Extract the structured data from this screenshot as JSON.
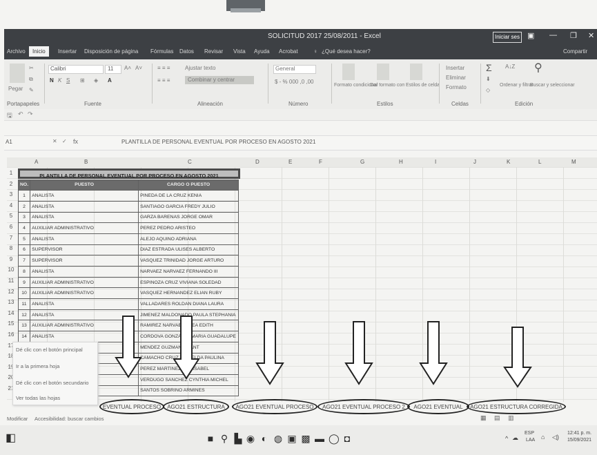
{
  "window": {
    "title": "SOLICITUD 2017 25/08/2011 - Excel",
    "sign_in": "Iniciar ses",
    "min": "—",
    "restore": "❐",
    "close": "✕"
  },
  "menu": [
    "Archivo",
    "Inicio",
    "Insertar",
    "Disposición de página",
    "Fórmulas",
    "Datos",
    "Revisar",
    "Vista",
    "Ayuda",
    "Acrobat",
    "¿Qué desea hacer?",
    "Compartir"
  ],
  "ribbon": {
    "paste": "Pegar",
    "font_name": "Calibri",
    "font_size": "11",
    "wrap_text": "Ajustar texto",
    "merge_center": "Combinar y centrar",
    "number_format": "General",
    "conditional_format": "Formato condicional",
    "format_as_table": "Dar formato como tabla",
    "cell_styles": "Estilos de celda",
    "insert": "Insertar",
    "delete": "Eliminar",
    "format": "Formato",
    "sort_filter": "Ordenar y filtrar",
    "find_select": "Buscar y seleccionar",
    "groups": [
      "Portapapeles",
      "Fuente",
      "Alineación",
      "Número",
      "Estilos",
      "Celdas",
      "Edición"
    ]
  },
  "formula_bar": {
    "cell_ref": "A1",
    "fx": "fx",
    "formula": "PLANTILLA DE PERSONAL EVENTUAL POR PROCESO EN AGOSTO 2021"
  },
  "columns": [
    "A",
    "B",
    "C",
    "D",
    "E",
    "F",
    "G",
    "H",
    "I",
    "J",
    "K",
    "L",
    "M"
  ],
  "table": {
    "title": "PLANTILLA DE PERSONAL EVENTUAL POR PROCESO EN AGOSTO 2021",
    "headers": [
      "NO.",
      "PUESTO",
      "CARGO O PUESTO"
    ],
    "rows": [
      {
        "n": "1",
        "puesto": "ANALISTA",
        "nombre": "PINEDA DE LA CRUZ KENIA"
      },
      {
        "n": "2",
        "puesto": "ANALISTA",
        "nombre": "SANTIAGO GARCIA FREDY JULIO"
      },
      {
        "n": "3",
        "puesto": "ANALISTA",
        "nombre": "GARZA BARENAS JORGE OMAR"
      },
      {
        "n": "4",
        "puesto": "AUXILIAR ADMINISTRATIVO",
        "nombre": "PEREZ PEDRO ARISTEO"
      },
      {
        "n": "5",
        "puesto": "ANALISTA",
        "nombre": "ALEJO AQUINO ADRIANA"
      },
      {
        "n": "6",
        "puesto": "SUPERVISOR",
        "nombre": "DIAZ ESTRADA ULISES ALBERTO"
      },
      {
        "n": "7",
        "puesto": "SUPERVISOR",
        "nombre": "VASQUEZ TRINIDAD JORGE ARTURO"
      },
      {
        "n": "8",
        "puesto": "ANALISTA",
        "nombre": "NARVAEZ NARVAEZ FERNANDO III"
      },
      {
        "n": "9",
        "puesto": "AUXILIAR ADMINISTRATIVO",
        "nombre": "ESPINOZA CRUZ VIVIANA SOLEDAD"
      },
      {
        "n": "10",
        "puesto": "AUXILIAR ADMINISTRATIVO",
        "nombre": "VASQUEZ HERNANDEZ ELIAN RUBY"
      },
      {
        "n": "11",
        "puesto": "ANALISTA",
        "nombre": "VALLADARES ROLDAN DIANA LAURA"
      },
      {
        "n": "12",
        "puesto": "ANALISTA",
        "nombre": "JIMENEZ MALDONADO PAULA STEPHANIA"
      },
      {
        "n": "13",
        "puesto": "AUXILIAR ADMINISTRATIVO",
        "nombre": "RAMIREZ NARVAEZ GLEA EDITH"
      },
      {
        "n": "14",
        "puesto": "ANALISTA",
        "nombre": "CORDOVA GONZALEZ MARIA GUADALUPE"
      },
      {
        "n": "",
        "puesto": "",
        "nombre": "MENDEZ GUZMAN GRANT"
      },
      {
        "n": "",
        "puesto": "",
        "nombre": "CAMACHO CRUZ GRISELDA PAULINA"
      },
      {
        "n": "",
        "puesto": "",
        "nombre": "PEREZ MARTINEZ ANA ISABEL"
      },
      {
        "n": "",
        "puesto": "",
        "nombre": "VERDUGO SANCHEZ CYNTHIA MICHEL"
      },
      {
        "n": "",
        "puesto": "",
        "nombre": "SANTOS SOBRINO ARMINES"
      }
    ]
  },
  "context_menu": [
    "Dé clic con el botón principal",
    "Ir a la primera hoja",
    "Dé clic con el botón secundario",
    "Ver todas las hojas"
  ],
  "sheet_tabs": [
    "EVENTUAL PROCESO",
    "AGO21 ESTRUCTURA",
    "AGO21 EVENTUAL PROCESO",
    "AGO21 EVENTUAL PROCESO 2",
    "AGO21 EVENTUAL",
    "AGO21 ESTRUCTURA CORREGIDA"
  ],
  "status": {
    "mode": "Modificar",
    "accessibility": "Accesibilidad: buscar cambios"
  },
  "taskbar": {
    "lang": "ESP",
    "lang2": "LAA",
    "time": "12:41 p. m.",
    "date": "15/09/2021"
  }
}
